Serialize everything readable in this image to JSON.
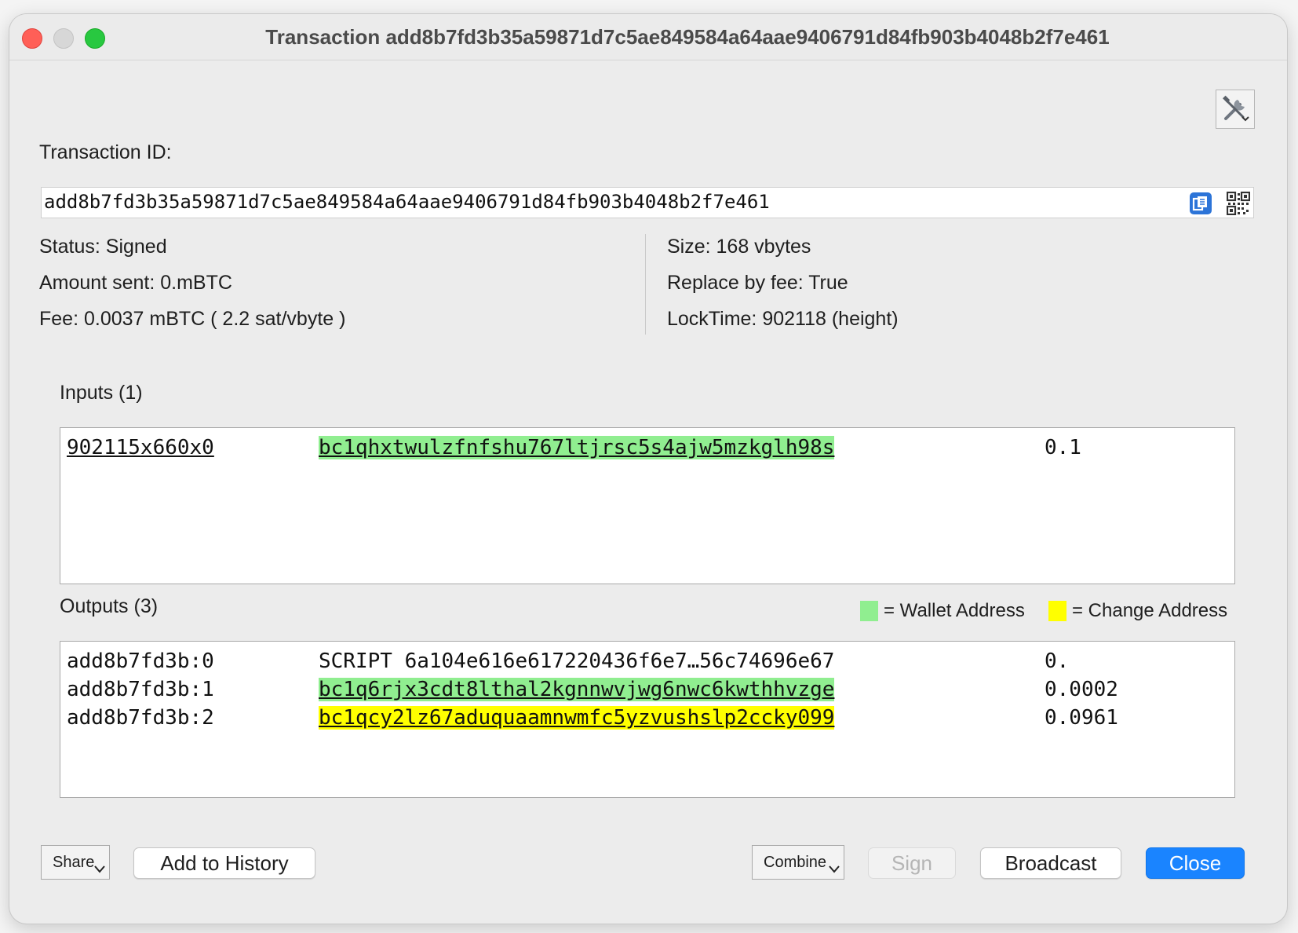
{
  "window": {
    "title": "Transaction add8b7fd3b35a59871d7c5ae849584a64aae9406791d84fb903b4048b2f7e461"
  },
  "toolbar": {
    "tools_icon": "tools-icon"
  },
  "txid": {
    "label": "Transaction ID:",
    "value": "add8b7fd3b35a59871d7c5ae849584a64aae9406791d84fb903b4048b2f7e461",
    "copy_icon": "copy-icon",
    "qr_icon": "qr-code-icon"
  },
  "details": {
    "status": "Status: Signed",
    "amount_sent": "Amount sent: 0.mBTC",
    "fee": "Fee: 0.0037 mBTC  ( 2.2 sat/vbyte )",
    "size": "Size: 168 vbytes",
    "rbf": "Replace by fee: True",
    "locktime": "LockTime: 902118 (height)"
  },
  "inputs": {
    "heading": "Inputs (1)",
    "rows": [
      {
        "prevout": "902115x660x0",
        "address": "bc1qhxtwulzfnfshu767ltjrsc5s4ajw5mzkglh98s",
        "amount": "0.1",
        "kind": "wallet"
      }
    ]
  },
  "outputs": {
    "heading": "Outputs (3)",
    "rows": [
      {
        "outpoint": "add8b7fd3b:0",
        "address": "SCRIPT 6a104e616e617220436f6e7…56c74696e67",
        "amount": "0.",
        "kind": "script"
      },
      {
        "outpoint": "add8b7fd3b:1",
        "address": "bc1q6rjx3cdt8lthal2kgnnwvjwg6nwc6kwthhvzge",
        "amount": "0.0002",
        "kind": "wallet"
      },
      {
        "outpoint": "add8b7fd3b:2",
        "address": "bc1qcy2lz67aduquaamnwmfc5yzvushslp2ccky099",
        "amount": "0.0961",
        "kind": "change"
      }
    ]
  },
  "legend": {
    "wallet": "= Wallet Address",
    "change": "= Change Address",
    "wallet_color": "#90ee90",
    "change_color": "#ffff00"
  },
  "buttons": {
    "share": "Share",
    "add_to_history": "Add to History",
    "combine": "Combine",
    "sign": "Sign",
    "broadcast": "Broadcast",
    "close": "Close"
  },
  "colors": {
    "accent": "#1a84ff",
    "close_dot": "#ff5f57",
    "max_dot": "#28c840"
  }
}
